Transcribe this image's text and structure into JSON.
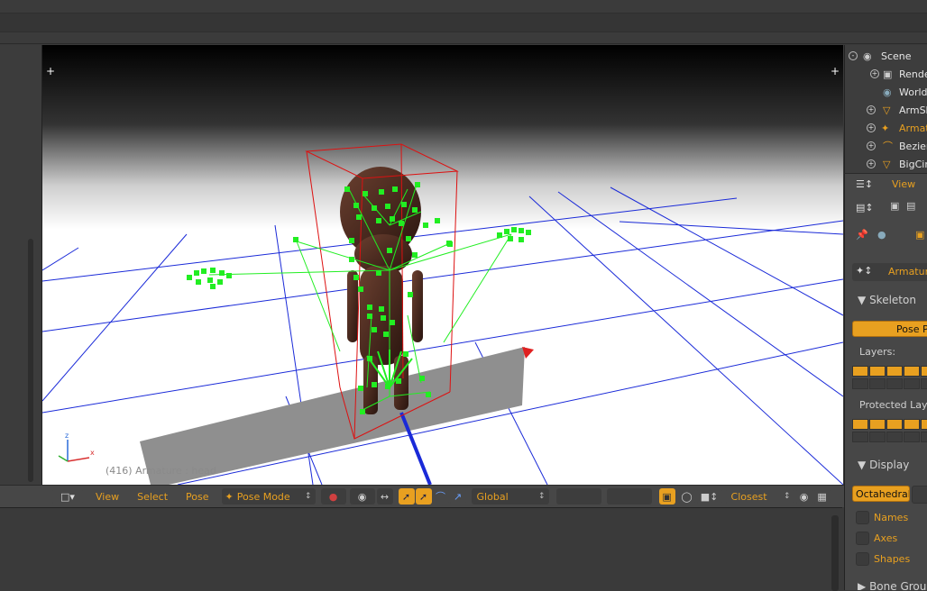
{
  "viewport": {
    "info": "(416) Armature : head"
  },
  "header3d": {
    "menus": [
      "View",
      "Select",
      "Pose"
    ],
    "mode": "Pose Mode",
    "orientation": "Global",
    "snap": "Closest"
  },
  "outliner": {
    "items": [
      {
        "label": "Scene"
      },
      {
        "label": "Rende"
      },
      {
        "label": "World"
      },
      {
        "label": "ArmSh"
      },
      {
        "label": "Armat"
      },
      {
        "label": "Bezier"
      },
      {
        "label": "BigCir"
      }
    ],
    "view_label": "View"
  },
  "properties": {
    "object_name": "Armature",
    "skeleton_header": "Skeleton",
    "pose_button": "Pose Po",
    "layers_label": "Layers:",
    "protected_label": "Protected Laye",
    "display_header": "Display",
    "display_type": "Octahedral",
    "options": [
      "Names",
      "Axes",
      "Shapes"
    ],
    "bone_groups": "Bone Group"
  },
  "colors": {
    "accent": "#e8a020",
    "bone": "#22ee22",
    "grid": "#1a2ad8",
    "bbox": "#dd1111"
  }
}
